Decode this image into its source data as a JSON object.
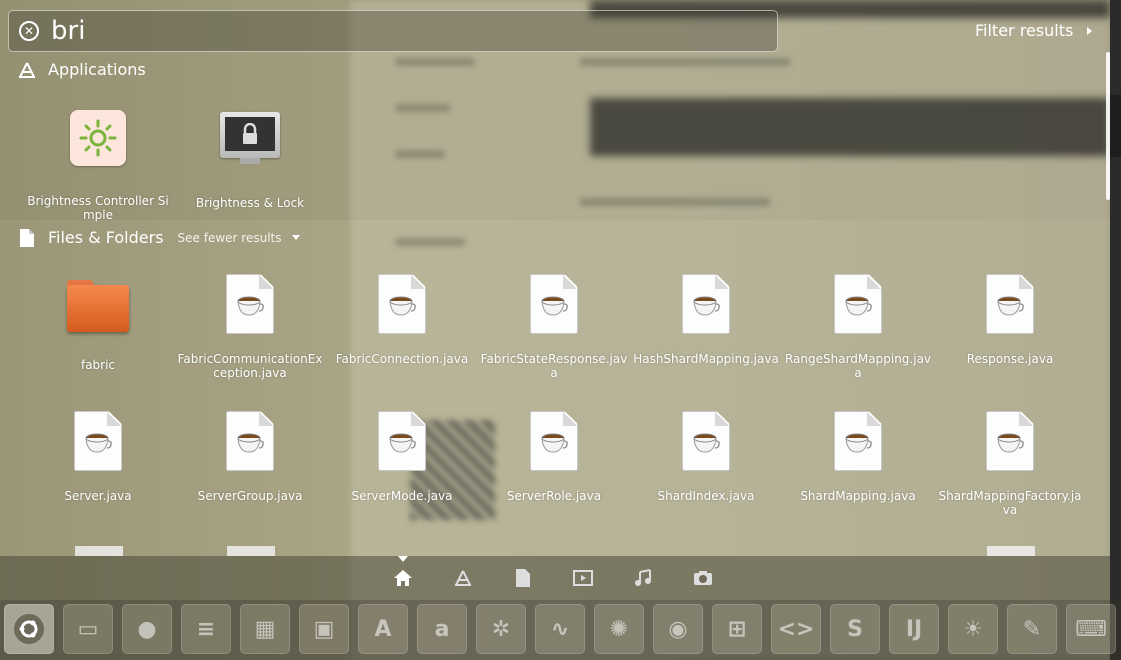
{
  "search": {
    "query": "bri"
  },
  "filter_results_label": "Filter results",
  "sections": {
    "applications": {
      "title": "Applications",
      "items": [
        {
          "label": "Brightness Controller Simple",
          "icon": "brightness-sun-icon"
        },
        {
          "label": "Brightness & Lock",
          "icon": "monitor-lock-icon"
        }
      ]
    },
    "files": {
      "title": "Files & Folders",
      "see_fewer": "See fewer results",
      "items": [
        {
          "label": "fabric",
          "icon": "folder-icon"
        },
        {
          "label": "FabricCommunicationException.java",
          "icon": "java-file-icon"
        },
        {
          "label": "FabricConnection.java",
          "icon": "java-file-icon"
        },
        {
          "label": "FabricStateResponse.java",
          "icon": "java-file-icon"
        },
        {
          "label": "HashShardMapping.java",
          "icon": "java-file-icon"
        },
        {
          "label": "RangeShardMapping.java",
          "icon": "java-file-icon"
        },
        {
          "label": "Response.java",
          "icon": "java-file-icon"
        },
        {
          "label": "Server.java",
          "icon": "java-file-icon"
        },
        {
          "label": "ServerGroup.java",
          "icon": "java-file-icon"
        },
        {
          "label": "ServerMode.java",
          "icon": "java-file-icon"
        },
        {
          "label": "ServerRole.java",
          "icon": "java-file-icon"
        },
        {
          "label": "ShardIndex.java",
          "icon": "java-file-icon"
        },
        {
          "label": "ShardMapping.java",
          "icon": "java-file-icon"
        },
        {
          "label": "ShardMappingFactory.java",
          "icon": "java-file-icon"
        }
      ]
    }
  },
  "lenses": [
    "home-icon",
    "applications-icon",
    "files-icon",
    "video-icon",
    "music-icon",
    "photos-icon"
  ],
  "dock": [
    "ubuntu-logo-icon",
    "files-manager-icon",
    "firefox-icon",
    "writer-icon",
    "calc-icon",
    "impress-icon",
    "software-center-icon",
    "amazon-icon",
    "system-settings-icon",
    "system-monitor-icon",
    "aperture-icon",
    "chromium-icon",
    "workspace-switcher-icon",
    "code-editor-icon",
    "sublime-icon",
    "intellij-icon",
    "brightness-icon",
    "text-editor-icon",
    "keyboard-icon"
  ],
  "colors": {
    "folder": "#e9703a",
    "accent": "#ffffff"
  }
}
